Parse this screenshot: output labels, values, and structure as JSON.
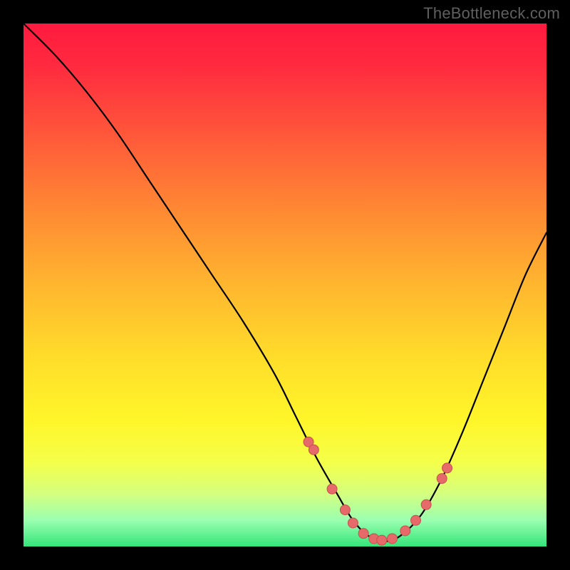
{
  "watermark": "TheBottleneck.com",
  "colors": {
    "curve": "#000000",
    "marker_fill": "#e76a6a",
    "marker_stroke": "#c84f4f"
  },
  "chart_data": {
    "type": "line",
    "title": "",
    "xlabel": "",
    "ylabel": "",
    "xlim": [
      0,
      100
    ],
    "ylim": [
      0,
      100
    ],
    "series": [
      {
        "name": "bottleneck-curve",
        "x": [
          0,
          6,
          12,
          18,
          24,
          30,
          36,
          42,
          48,
          52,
          56,
          60,
          63,
          66,
          69,
          72,
          76,
          80,
          84,
          88,
          92,
          96,
          100
        ],
        "y": [
          100,
          94,
          87,
          79,
          70,
          61,
          52,
          43,
          33,
          25,
          17,
          10,
          5,
          2,
          1,
          2,
          6,
          13,
          22,
          32,
          42,
          52,
          60
        ]
      }
    ],
    "markers": {
      "name": "highlighted-samples",
      "x": [
        54.5,
        55.5,
        59.0,
        61.5,
        63.0,
        65.0,
        67.0,
        68.5,
        70.5,
        73.0,
        75.0,
        77.0,
        80.0,
        81.0
      ],
      "y": [
        20.0,
        18.5,
        11.0,
        7.0,
        4.5,
        2.5,
        1.5,
        1.2,
        1.5,
        3.0,
        5.0,
        8.0,
        13.0,
        15.0
      ]
    }
  }
}
